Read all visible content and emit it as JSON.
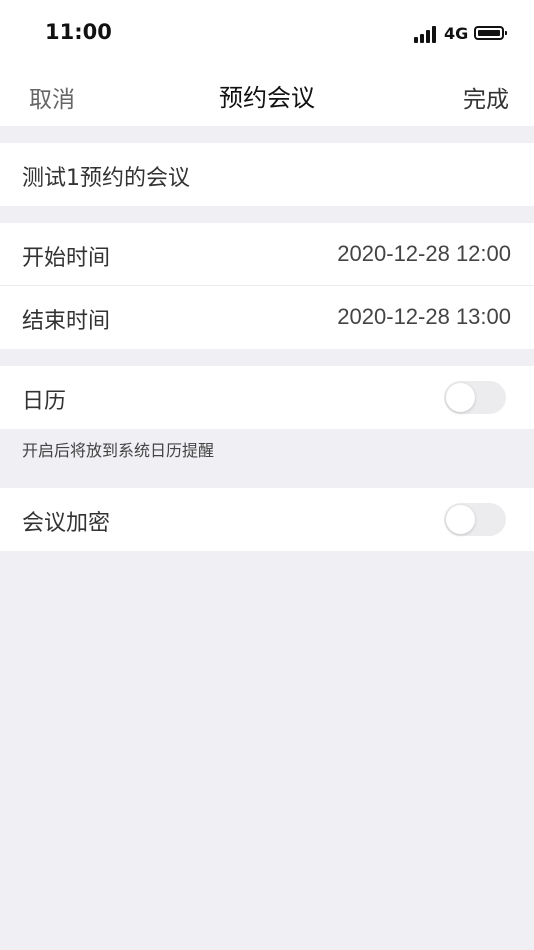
{
  "status_bar": {
    "time": "11:00",
    "network": "4G",
    "signal_icon": "signal-bars-icon",
    "battery_icon": "battery-icon"
  },
  "nav": {
    "cancel_label": "取消",
    "title": "预约会议",
    "done_label": "完成"
  },
  "meeting": {
    "subject": "测试1预约的会议"
  },
  "time_section": {
    "start_label": "开始时间",
    "start_value": "2020-12-28 12:00",
    "end_label": "结束时间",
    "end_value": "2020-12-28 13:00"
  },
  "calendar": {
    "label": "日历",
    "enabled": false,
    "hint": "开启后将放到系统日历提醒"
  },
  "encryption": {
    "label": "会议加密",
    "enabled": false
  },
  "colors": {
    "background": "#efeff4",
    "card": "#ffffff",
    "toggle_off": "#ececee"
  }
}
